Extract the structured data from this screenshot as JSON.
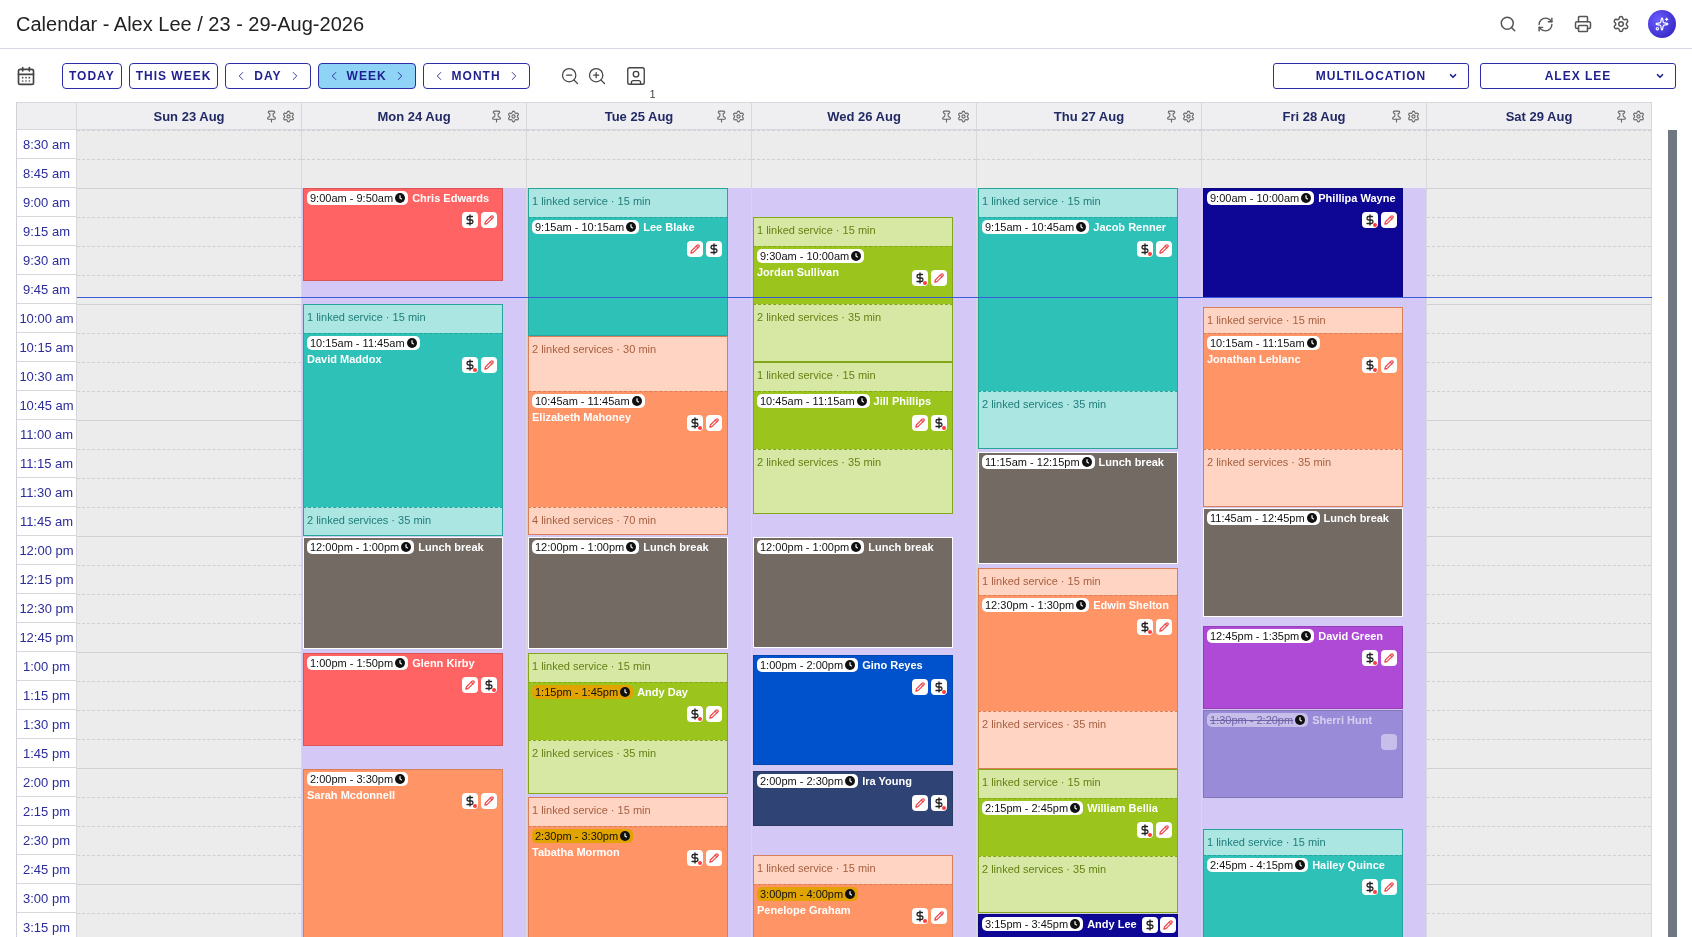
{
  "window": {
    "title": "Calendar - Alex Lee / 23 - 29-Aug-2026"
  },
  "toolbar": {
    "quick_buttons": [
      "TODAY",
      "THIS WEEK"
    ],
    "views": [
      {
        "label": "DAY",
        "selected": false
      },
      {
        "label": "WEEK",
        "selected": true
      },
      {
        "label": "MONTH",
        "selected": false
      }
    ],
    "staff_count": "1",
    "dropdowns": [
      "MULTILOCATION",
      "ALEX LEE"
    ]
  },
  "times": [
    "8:30 am",
    "8:45 am",
    "9:00 am",
    "9:15 am",
    "9:30 am",
    "9:45 am",
    "10:00 am",
    "10:15 am",
    "10:30 am",
    "10:45 am",
    "11:00 am",
    "11:15 am",
    "11:30 am",
    "11:45 am",
    "12:00 pm",
    "12:15 pm",
    "12:30 pm",
    "12:45 pm",
    "1:00 pm",
    "1:15 pm",
    "1:30 pm",
    "1:45 pm",
    "2:00 pm",
    "2:15 pm",
    "2:30 pm",
    "2:45 pm",
    "3:00 pm",
    "3:15 pm"
  ],
  "days": [
    {
      "label": "Sun 23 Aug",
      "open": false
    },
    {
      "label": "Mon 24 Aug",
      "open": true,
      "blocks": [
        {
          "color": "#ff6363",
          "segments": [
            {
              "kind": "appointment",
              "time": "9:00am - 9:50am",
              "name": "Chris Edwards",
              "highlighted": false,
              "cancelled": false,
              "icons": [
                {
                  "kind": "payment",
                  "due": false
                },
                {
                  "kind": "edit"
                }
              ]
            }
          ]
        },
        {
          "color": "#2ec1b8",
          "segments": [
            {
              "kind": "linked",
              "label": "1 linked service · 15 min"
            },
            {
              "kind": "appointment",
              "time": "10:15am - 11:45am",
              "name": "David Maddox",
              "highlighted": false,
              "cancelled": false,
              "icons": [
                {
                  "kind": "payment",
                  "due": true
                },
                {
                  "kind": "edit"
                }
              ]
            },
            {
              "kind": "linked",
              "label": "2 linked services · 35 min"
            }
          ]
        },
        {
          "color": "#736a64",
          "segments": [
            {
              "kind": "break",
              "time": "12:00pm - 1:00pm",
              "label": "Lunch break"
            }
          ]
        },
        {
          "color": "#ff6363",
          "segments": [
            {
              "kind": "appointment",
              "time": "1:00pm - 1:50pm",
              "name": "Glenn Kirby",
              "highlighted": false,
              "cancelled": false,
              "icons": [
                {
                  "kind": "edit"
                },
                {
                  "kind": "payment",
                  "due": true
                }
              ]
            }
          ]
        },
        {
          "color": "#ff9466",
          "segments": [
            {
              "kind": "appointment",
              "time": "2:00pm - 3:30pm",
              "name": "Sarah Mcdonnell",
              "highlighted": false,
              "cancelled": false,
              "icons": [
                {
                  "kind": "payment",
                  "due": true
                },
                {
                  "kind": "edit"
                }
              ]
            }
          ]
        }
      ]
    },
    {
      "label": "Tue 25 Aug",
      "open": true,
      "blocks": [
        {
          "color": "#2ec1b8",
          "segments": [
            {
              "kind": "linked",
              "label": "1 linked service · 15 min"
            },
            {
              "kind": "appointment",
              "time": "9:15am - 10:15am",
              "name": "Lee Blake",
              "highlighted": false,
              "cancelled": false,
              "icons": [
                {
                  "kind": "edit"
                },
                {
                  "kind": "payment",
                  "due": false
                }
              ]
            }
          ]
        },
        {
          "color": "#ff9466",
          "segments": [
            {
              "kind": "linked",
              "label": "2 linked services · 30 min"
            },
            {
              "kind": "appointment",
              "time": "10:45am - 11:45am",
              "name": "Elizabeth Mahoney",
              "highlighted": false,
              "cancelled": false,
              "icons": [
                {
                  "kind": "payment",
                  "due": true
                },
                {
                  "kind": "edit"
                }
              ]
            },
            {
              "kind": "linked",
              "label": "4 linked services · 70 min"
            }
          ]
        },
        {
          "color": "#736a64",
          "segments": [
            {
              "kind": "break",
              "time": "12:00pm - 1:00pm",
              "label": "Lunch break"
            }
          ]
        },
        {
          "color": "#9bc51d",
          "segments": [
            {
              "kind": "linked",
              "label": "1 linked service · 15 min"
            },
            {
              "kind": "appointment",
              "time": "1:15pm - 1:45pm",
              "name": "Andy Day",
              "highlighted": true,
              "cancelled": false,
              "icons": [
                {
                  "kind": "payment",
                  "due": true
                },
                {
                  "kind": "edit"
                }
              ]
            },
            {
              "kind": "linked",
              "label": "2 linked services · 35 min"
            }
          ]
        },
        {
          "color": "#ff9466",
          "segments": [
            {
              "kind": "linked",
              "label": "1 linked service · 15 min"
            },
            {
              "kind": "appointment",
              "time": "2:30pm - 3:30pm",
              "name": "Tabatha Mormon",
              "highlighted": true,
              "cancelled": false,
              "icons": [
                {
                  "kind": "payment",
                  "due": true
                },
                {
                  "kind": "edit"
                }
              ]
            }
          ]
        }
      ]
    },
    {
      "label": "Wed 26 Aug",
      "open": true,
      "blocks": [
        {
          "color": "#9bc51d",
          "segments": [
            {
              "kind": "linked",
              "label": "1 linked service · 15 min"
            },
            {
              "kind": "appointment",
              "time": "9:30am - 10:00am",
              "name": "Jordan Sullivan",
              "highlighted": false,
              "cancelled": false,
              "icons": [
                {
                  "kind": "payment",
                  "due": true
                },
                {
                  "kind": "edit"
                }
              ]
            },
            {
              "kind": "linked",
              "label": "2 linked services · 35 min"
            }
          ]
        },
        {
          "color": "#9bc51d",
          "segments": [
            {
              "kind": "linked",
              "label": "1 linked service · 15 min"
            },
            {
              "kind": "appointment",
              "time": "10:45am - 11:15am",
              "name": "Jill Phillips",
              "highlighted": false,
              "cancelled": false,
              "icons": [
                {
                  "kind": "edit"
                },
                {
                  "kind": "payment",
                  "due": true
                }
              ]
            },
            {
              "kind": "linked",
              "label": "2 linked services · 35 min"
            }
          ]
        },
        {
          "color": "#736a64",
          "segments": [
            {
              "kind": "break",
              "time": "12:00pm - 1:00pm",
              "label": "Lunch break"
            }
          ]
        },
        {
          "color": "#0052cc",
          "segments": [
            {
              "kind": "appointment",
              "time": "1:00pm - 2:00pm",
              "name": "Gino Reyes",
              "highlighted": false,
              "cancelled": false,
              "icons": [
                {
                  "kind": "edit"
                },
                {
                  "kind": "payment",
                  "due": true
                }
              ]
            }
          ]
        },
        {
          "color": "#2f4374",
          "segments": [
            {
              "kind": "appointment",
              "time": "2:00pm - 2:30pm",
              "name": "Ira Young",
              "highlighted": false,
              "cancelled": false,
              "icons": [
                {
                  "kind": "edit"
                },
                {
                  "kind": "payment",
                  "due": true
                }
              ]
            }
          ]
        },
        {
          "color": "#ff9466",
          "segments": [
            {
              "kind": "linked",
              "label": "1 linked service · 15 min"
            },
            {
              "kind": "appointment",
              "time": "3:00pm - 4:00pm",
              "name": "Penelope Graham",
              "highlighted": true,
              "cancelled": false,
              "icons": [
                {
                  "kind": "payment",
                  "due": true
                },
                {
                  "kind": "edit"
                }
              ]
            }
          ]
        }
      ]
    },
    {
      "label": "Thu 27 Aug",
      "open": true,
      "blocks": [
        {
          "color": "#2ec1b8",
          "segments": [
            {
              "kind": "linked",
              "label": "1 linked service · 15 min"
            },
            {
              "kind": "appointment",
              "time": "9:15am - 10:45am",
              "name": "Jacob Renner",
              "highlighted": false,
              "cancelled": false,
              "icons": [
                {
                  "kind": "payment",
                  "due": true
                },
                {
                  "kind": "edit"
                }
              ]
            },
            {
              "kind": "linked",
              "label": "2 linked services · 35 min"
            }
          ]
        },
        {
          "color": "#736a64",
          "segments": [
            {
              "kind": "break",
              "time": "11:15am - 12:15pm",
              "label": "Lunch break"
            }
          ]
        },
        {
          "color": "#ff9466",
          "segments": [
            {
              "kind": "linked",
              "label": "1 linked service · 15 min"
            },
            {
              "kind": "appointment",
              "time": "12:30pm - 1:30pm",
              "name": "Edwin Shelton",
              "highlighted": false,
              "cancelled": false,
              "icons": [
                {
                  "kind": "payment",
                  "due": true
                },
                {
                  "kind": "edit"
                }
              ]
            },
            {
              "kind": "linked",
              "label": "2 linked services · 35 min"
            }
          ]
        },
        {
          "color": "#9bc51d",
          "segments": [
            {
              "kind": "linked",
              "label": "1 linked service · 15 min"
            },
            {
              "kind": "appointment",
              "time": "2:15pm - 2:45pm",
              "name": "William Bellia",
              "highlighted": false,
              "cancelled": false,
              "icons": [
                {
                  "kind": "payment",
                  "due": true
                },
                {
                  "kind": "edit"
                }
              ]
            },
            {
              "kind": "linked",
              "label": "2 linked services · 35 min"
            }
          ]
        },
        {
          "color": "#0e0795",
          "segments": [
            {
              "kind": "appointment",
              "time": "3:15pm - 3:45pm",
              "name": "Andy Lee",
              "highlighted": false,
              "cancelled": false,
              "icons": [
                {
                  "kind": "payment",
                  "due": false
                },
                {
                  "kind": "edit"
                }
              ]
            }
          ]
        }
      ]
    },
    {
      "label": "Fri 28 Aug",
      "open": true,
      "blocks": [
        {
          "color": "#0e0795",
          "segments": [
            {
              "kind": "appointment",
              "time": "9:00am - 10:00am",
              "name": "Phillipa Wayne",
              "highlighted": false,
              "cancelled": false,
              "icons": [
                {
                  "kind": "payment",
                  "due": true
                },
                {
                  "kind": "edit"
                }
              ]
            }
          ]
        },
        {
          "color": "#ff9466",
          "segments": [
            {
              "kind": "linked",
              "label": "1 linked service · 15 min"
            },
            {
              "kind": "appointment",
              "time": "10:15am - 11:15am",
              "name": "Jonathan Leblanc",
              "highlighted": false,
              "cancelled": false,
              "icons": [
                {
                  "kind": "payment",
                  "due": true
                },
                {
                  "kind": "edit"
                }
              ]
            },
            {
              "kind": "linked",
              "label": "2 linked services · 35 min"
            }
          ]
        },
        {
          "color": "#736a64",
          "segments": [
            {
              "kind": "break",
              "time": "11:45am - 12:45pm",
              "label": "Lunch break"
            }
          ]
        },
        {
          "color": "#ae4ad6",
          "segments": [
            {
              "kind": "appointment",
              "time": "12:45pm - 1:35pm",
              "name": "David Green",
              "highlighted": false,
              "cancelled": false,
              "icons": [
                {
                  "kind": "payment",
                  "due": true
                },
                {
                  "kind": "edit"
                }
              ]
            }
          ]
        },
        {
          "color": "#9a8bd9",
          "segments": [
            {
              "kind": "appointment",
              "time": "1:30pm - 2:20pm",
              "name": "Sherri Hunt",
              "highlighted": false,
              "cancelled": true,
              "icons": [
                {
                  "kind": "edit"
                }
              ]
            }
          ]
        },
        {
          "color": "#2ec1b8",
          "segments": [
            {
              "kind": "linked",
              "label": "1 linked service · 15 min"
            },
            {
              "kind": "appointment",
              "time": "2:45pm - 4:15pm",
              "name": "Hailey Quince",
              "highlighted": false,
              "cancelled": false,
              "icons": [
                {
                  "kind": "payment",
                  "due": true
                },
                {
                  "kind": "edit"
                }
              ]
            }
          ]
        }
      ]
    },
    {
      "label": "Sat 29 Aug",
      "open": false
    }
  ]
}
